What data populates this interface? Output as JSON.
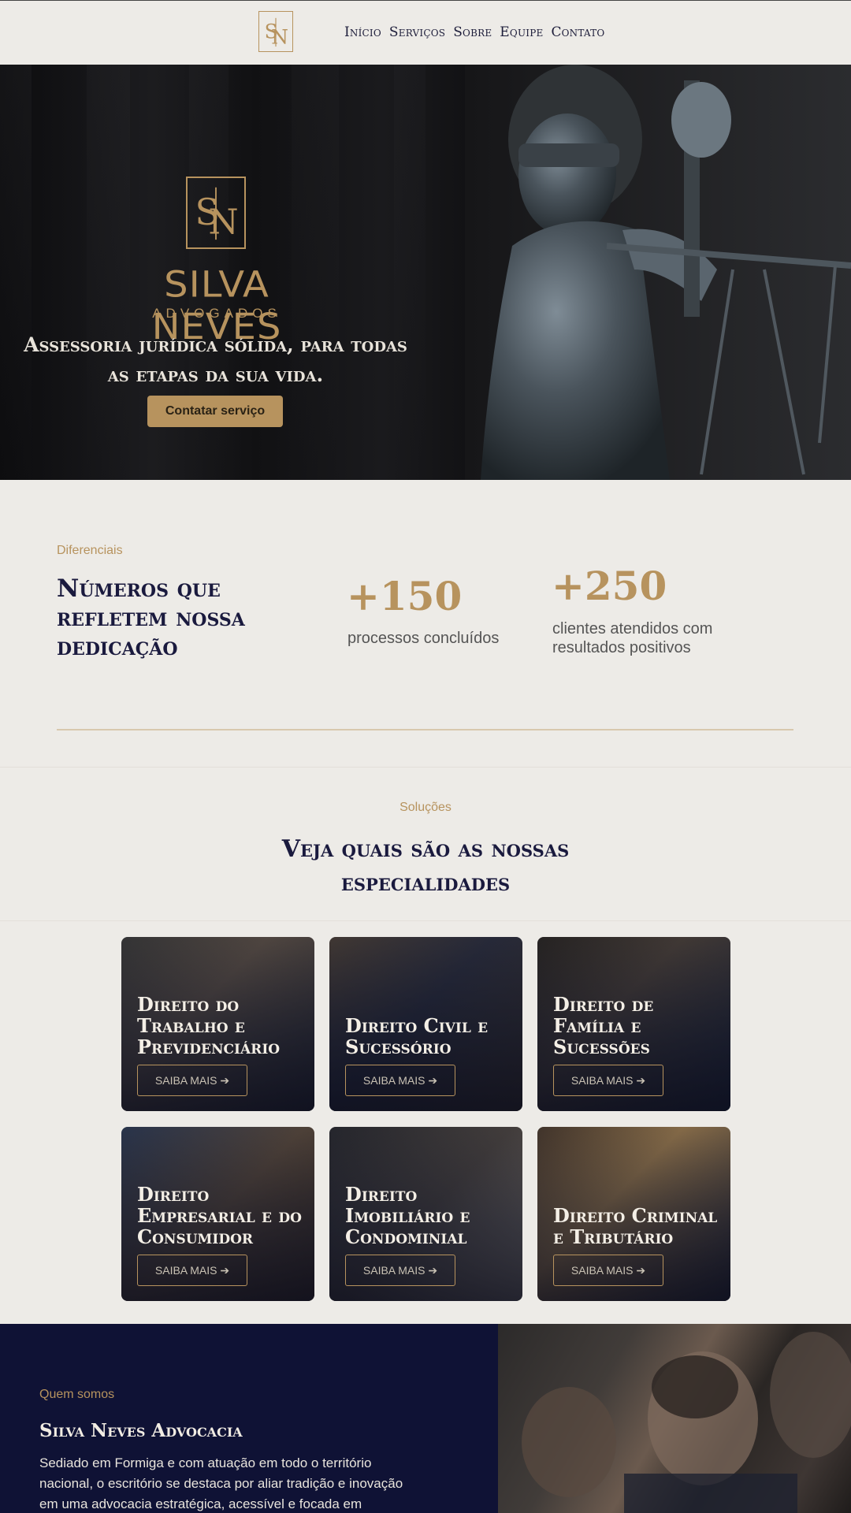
{
  "nav": {
    "logo_text": "SN",
    "items": [
      "Início",
      "Serviços",
      "Sobre",
      "Equipe",
      "Contato"
    ]
  },
  "hero": {
    "brand_name": "SILVA NEVES",
    "brand_sub": "ADVOGADOS",
    "tagline": "Assessoria jurídica sólida, para todas as etapas da sua vida.",
    "cta_label": "Contatar serviço"
  },
  "stats": {
    "kicker": "Diferenciais",
    "title": "Números que refletem nossa dedicação",
    "items": [
      {
        "value": "+150",
        "label": "processos concluídos"
      },
      {
        "value": "+250",
        "label": "clientes atendidos com resultados positivos"
      }
    ]
  },
  "solutions": {
    "kicker": "Soluções",
    "title": "Veja quais são as nossas especialidades",
    "cards": [
      {
        "title": "Direito do Trabalho e Previdenciário",
        "button": "SAIBA MAIS ➔"
      },
      {
        "title": "Direito Civil e Sucessório",
        "button": "SAIBA MAIS ➔"
      },
      {
        "title": "Direito de Família e Sucessões",
        "button": "SAIBA MAIS ➔"
      },
      {
        "title": "Direito Empresarial e do Consumidor",
        "button": "SAIBA MAIS ➔"
      },
      {
        "title": "Direito Imobiliário e Condominial",
        "button": "SAIBA MAIS ➔"
      },
      {
        "title": "Direito Criminal e Tributário",
        "button": "SAIBA MAIS ➔"
      }
    ]
  },
  "about": {
    "kicker": "Quem somos",
    "title": "Silva Neves Advocacia",
    "text": "Sediado em Formiga e com atuação em todo o território nacional, o escritório se destaca por aliar tradição e inovação em uma advocacia estratégica, acessível e focada em"
  },
  "colors": {
    "gold": "#b7935e",
    "navy": "#1a1a3e",
    "background": "#edebe7",
    "about_background": "#0f1235"
  }
}
